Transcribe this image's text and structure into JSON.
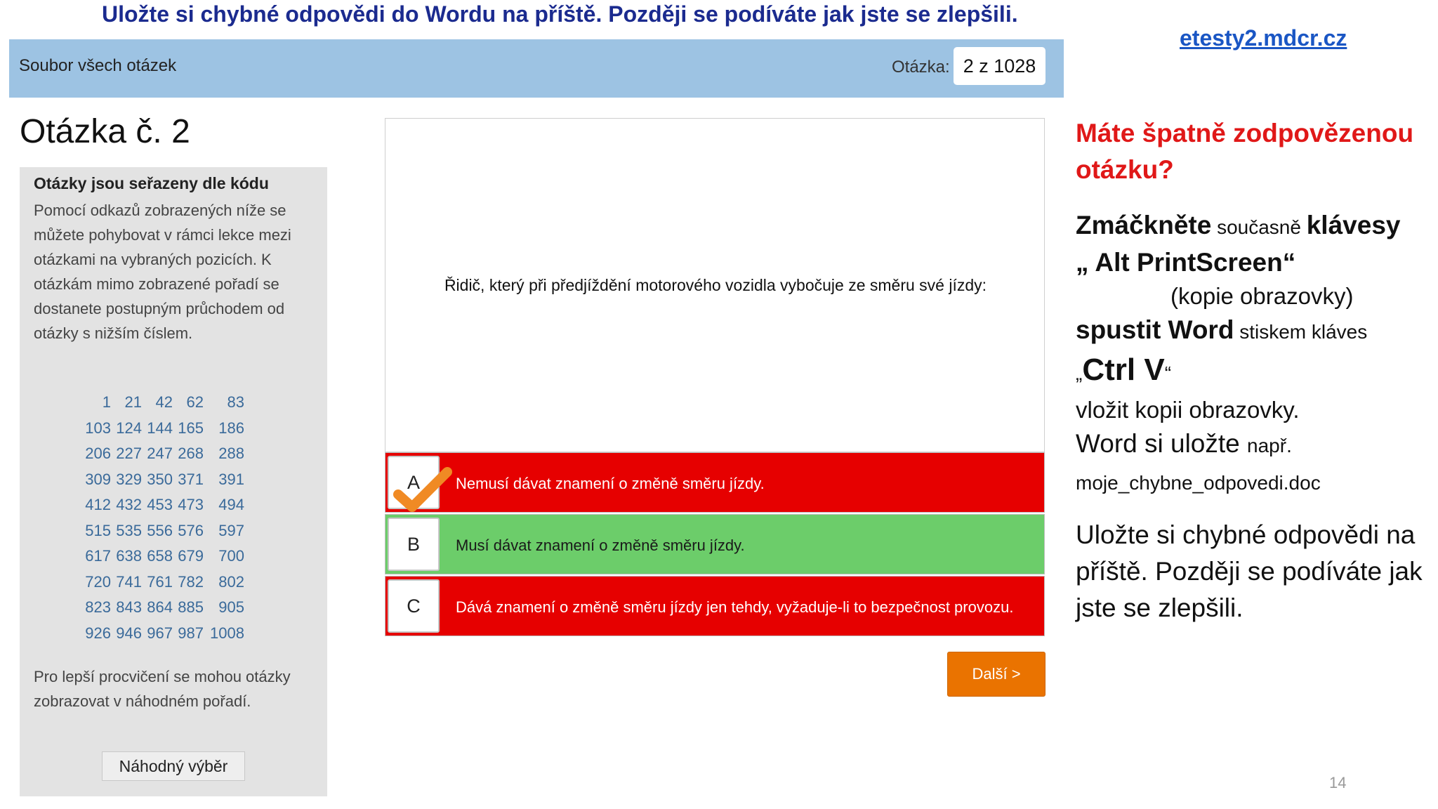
{
  "banner": "Uložte si chybné odpovědi do Wordu na příště. Později se podíváte jak jste se zlepšili.",
  "site_link": "etesty2.mdcr.cz",
  "header": {
    "title": "Soubor všech otázek",
    "counter_label": "Otázka:",
    "counter_value": "2 z 1028"
  },
  "question": {
    "heading": "Otázka č. 2",
    "text": "Řidič, který při předjíždění motorového vozidla vybočuje ze směru své jízdy:"
  },
  "sidebar": {
    "title": "Otázky jsou seřazeny dle kódu",
    "description": "Pomocí odkazů zobrazených níže se můžete pohybovat v rámci lekce mezi otázkami na vybraných pozicích. K otázkám mimo zobrazené pořadí se dostanete postupným průchodem od otázky s nižším číslem.",
    "numbers": [
      "1",
      "21",
      "42",
      "62",
      "83",
      "103",
      "124",
      "144",
      "165",
      "186",
      "206",
      "227",
      "247",
      "268",
      "288",
      "309",
      "329",
      "350",
      "371",
      "391",
      "412",
      "432",
      "453",
      "473",
      "494",
      "515",
      "535",
      "556",
      "576",
      "597",
      "617",
      "638",
      "658",
      "679",
      "700",
      "720",
      "741",
      "761",
      "782",
      "802",
      "823",
      "843",
      "864",
      "885",
      "905",
      "926",
      "946",
      "967",
      "987",
      "1008"
    ],
    "note": "Pro lepší procvičení se mohou otázky zobrazovat v náhodném pořadí.",
    "random_button": "Náhodný výběr"
  },
  "answers": [
    {
      "letter": "A",
      "text": "Nemusí dávat znamení o změně směru jízdy.",
      "status": "wrong-selected",
      "color": "#e60000"
    },
    {
      "letter": "B",
      "text": "Musí dávat znamení o změně směru jízdy.",
      "status": "correct",
      "color": "#6ccd6a"
    },
    {
      "letter": "C",
      "text": "Dává znamení o změně směru jízdy jen tehdy, vyžaduje-li to bezpečnost provozu.",
      "status": "wrong",
      "color": "#e60000"
    }
  ],
  "next_button": "Další >",
  "instructions": {
    "heading": "Máte špatně zodpovězenou otázku?",
    "l1_a": "Zmáčkněte",
    "l1_b": " současně ",
    "l1_c": "klávesy",
    "l2": "„ Alt  PrintScreen“",
    "l3": "(kopie obrazovky)",
    "l4_a": "spustit Word",
    "l4_b": " stiskem kláves",
    "l5_a": "„",
    "l5_b": "Ctrl V",
    "l5_c": "“",
    "l6": "vložit kopii obrazovky.",
    "l7_a": "Word si uložte ",
    "l7_b": " např.",
    "l8": "moje_chybne_odpovedi.doc",
    "closing": "Uložte si chybné odpovědi na příště. Později se podíváte jak jste se zlepšili."
  },
  "page_number": "14",
  "colors": {
    "accent_blue": "#9dc3e3",
    "wrong": "#e60000",
    "correct": "#6ccd6a",
    "next": "#ea7300",
    "check": "#f08a24"
  },
  "icons": {
    "selected_mark": "checkmark-icon"
  }
}
